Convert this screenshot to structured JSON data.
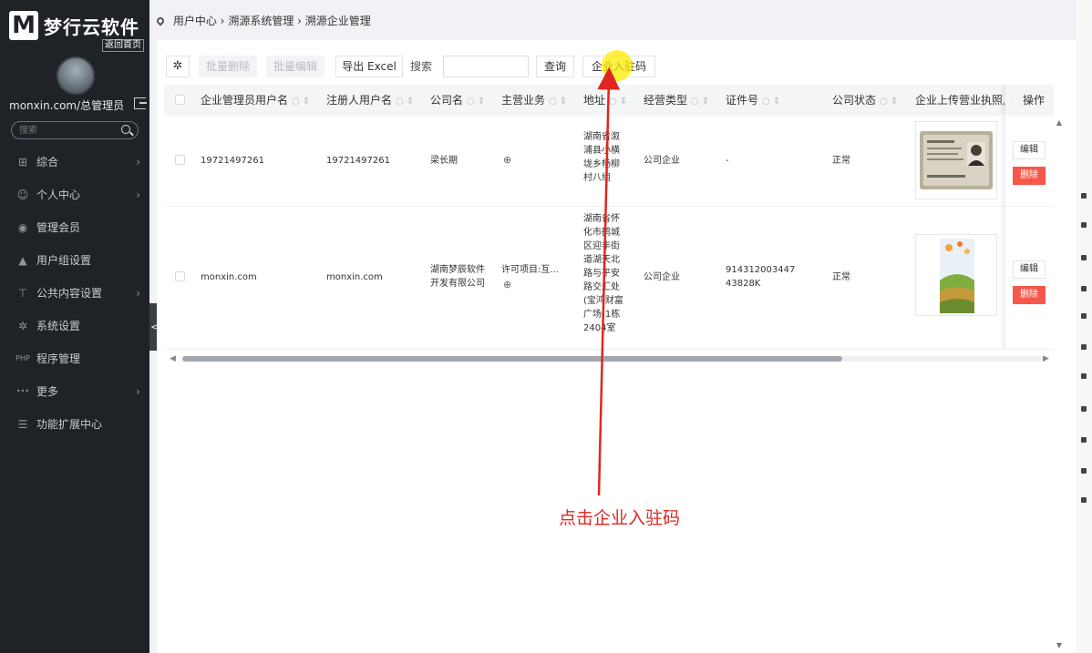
{
  "sidebar": {
    "logo_mark": "M",
    "logo_text": "梦行云软件",
    "back_home": "返回首页",
    "user": "monxin.com/总管理员",
    "search_placeholder": "搜索",
    "items": [
      {
        "label": "综合",
        "icon": "grid-icon",
        "glyph": "⊞",
        "chevron": "›"
      },
      {
        "label": "个人中心",
        "icon": "user-icon",
        "glyph": "☺",
        "chevron": "›"
      },
      {
        "label": "管理会员",
        "icon": "members-icon",
        "glyph": "◉",
        "chevron": ""
      },
      {
        "label": "用户组设置",
        "icon": "group-icon",
        "glyph": "▲",
        "chevron": ""
      },
      {
        "label": "公共内容设置",
        "icon": "content-icon",
        "glyph": "⊤",
        "chevron": "›"
      },
      {
        "label": "系统设置",
        "icon": "settings-icon",
        "glyph": "✲",
        "chevron": ""
      },
      {
        "label": "程序管理",
        "icon": "php-icon",
        "glyph": "PHP",
        "chevron": ""
      },
      {
        "label": "更多",
        "icon": "more-icon",
        "glyph": "•••",
        "chevron": "›"
      },
      {
        "label": "功能扩展中心",
        "icon": "menu-icon",
        "glyph": "☰",
        "chevron": ""
      }
    ],
    "collapse": "<"
  },
  "breadcrumb": {
    "items": [
      "用户中心",
      "溯源系统管理",
      "溯源企业管理"
    ],
    "sep": "›"
  },
  "toolbar": {
    "batch_delete": "批量删除",
    "batch_edit": "批量编辑",
    "export_excel": "导出 Excel",
    "search_label": "搜索",
    "search_value": "",
    "query": "查询",
    "enterprise_code": "企业入驻码"
  },
  "table": {
    "columns": [
      "企业管理员用户名",
      "注册人用户名",
      "公司名",
      "主营业务",
      "地址",
      "经营类型",
      "证件号",
      "公司状态",
      "企业上传营业执照,",
      "操作"
    ],
    "rows": [
      {
        "admin_username": "19721497261",
        "registrant": "19721497261",
        "company": "梁长期",
        "business": "",
        "address": "湖南省溆浦县小横垅乡杨柳村八组",
        "business_type": "公司企业",
        "cert_no": "-",
        "status": "正常"
      },
      {
        "admin_username": "monxin.com",
        "registrant": "monxin.com",
        "company": "湖南梦辰软件开发有限公司",
        "business": "许可项目:互...",
        "address": "湖南省怀化市鹤城区迎丰街道湖天北路与平安路交汇处(宝鸿财富广场)1栋2404室",
        "business_type": "公司企业",
        "cert_no": "91431200344743828K",
        "status": "正常"
      }
    ],
    "edit_label": "编辑",
    "delete_label": "删除"
  },
  "annotation": "点击企业入驻码",
  "colors": {
    "sidebar_bg": "#1f2328",
    "delete_red": "#f5584a",
    "annotation_red": "#e0261f",
    "highlight_yellow": "#ffec00"
  }
}
